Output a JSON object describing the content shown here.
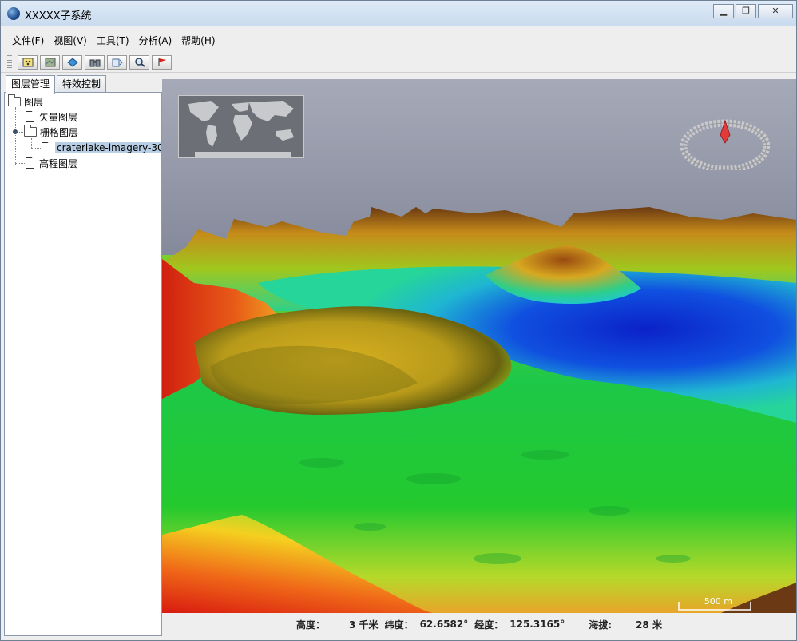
{
  "window": {
    "title": "XXXXX子系统"
  },
  "menu": [
    {
      "label": "文件(F)"
    },
    {
      "label": "视图(V)"
    },
    {
      "label": "工具(T)"
    },
    {
      "label": "分析(A)"
    },
    {
      "label": "帮助(H)"
    }
  ],
  "toolbar": [
    {
      "icon": "select-icon"
    },
    {
      "icon": "map-icon"
    },
    {
      "icon": "navigate-icon"
    },
    {
      "icon": "binoculars-icon"
    },
    {
      "icon": "measure-icon"
    },
    {
      "icon": "zoom-icon"
    },
    {
      "icon": "flag-icon"
    }
  ],
  "tabs": [
    {
      "label": "图层管理",
      "active": true
    },
    {
      "label": "特效控制",
      "active": false
    }
  ],
  "tree": {
    "root": "图层",
    "vector": "矢量图层",
    "raster": "栅格图层",
    "raster_child": "craterlake-imagery-30m",
    "elevation": "高程图层"
  },
  "map": {
    "scale_label": "500 m"
  },
  "status": {
    "altitude_label": "高度：",
    "altitude_value": "3 千米",
    "lat_label": "纬度：",
    "lat_value": "62.6582°",
    "lon_label": "经度：",
    "lon_value": "125.3165°",
    "elev_label": "海拔:",
    "elev_value": "28 米"
  },
  "colors": {
    "terrain_low": "#0a2fd0",
    "terrain_mid": "#1fc83a",
    "terrain_high": "#e52a12",
    "sky_top": "#a8abb8",
    "sky_bottom": "#3a3f58"
  }
}
